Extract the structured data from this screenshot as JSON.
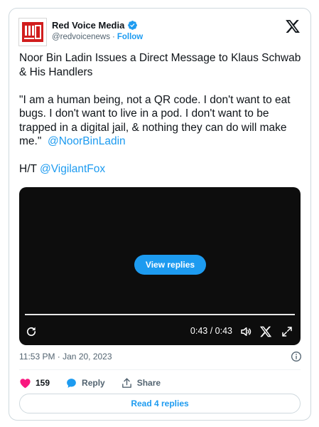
{
  "author": {
    "display_name": "Red Voice Media",
    "handle": "@redvoicenews",
    "separator": "·",
    "follow_label": "Follow",
    "avatar_icon": "red-voice-media-logo",
    "verified_icon": "verified-badge-icon"
  },
  "tweet": {
    "line1": "Noor Bin Ladin Issues a Direct Message to Klaus Schwab & His Handlers",
    "quote": "\"I am a human being, not a QR code. I don't want to eat bugs. I don't want to live in a pod. I don't want to be trapped in a digital jail, & nothing they can do will make me.\"",
    "quote_mention": "@NoorBinLadin",
    "ht_prefix": "H/T",
    "ht_mention": "@VigilantFox"
  },
  "video": {
    "view_replies_label": "View replies",
    "time_label": "0:43 / 0:43",
    "progress_fraction": 1.0
  },
  "meta": {
    "timestamp": "11:53 PM · Jan 20, 2023"
  },
  "actions": {
    "like_count": "159",
    "reply_label": "Reply",
    "share_label": "Share"
  },
  "footer": {
    "read_replies_label": "Read 4 replies"
  },
  "colors": {
    "accent": "#1d9bf0",
    "like": "#f91880",
    "text": "#0f1419",
    "muted": "#536471"
  }
}
